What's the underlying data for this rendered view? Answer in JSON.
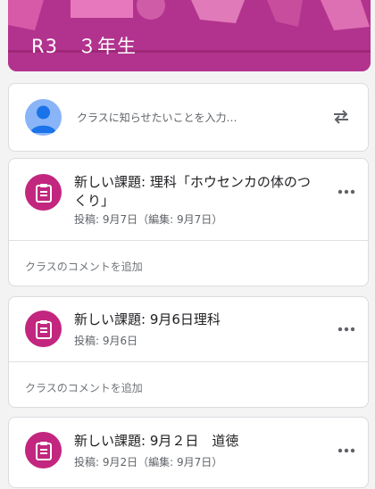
{
  "banner": {
    "title": "R3　３年生",
    "color": "#b2338e"
  },
  "composer": {
    "placeholder": "クラスに知らせたいことを入力…",
    "avatar_icon": "person-icon",
    "repost_icon": "repost-icon"
  },
  "posts": [
    {
      "title": "新しい課題: 理科「ホウセンカの体のつくり」",
      "meta": "投稿: 9月7日（編集: 9月7日）",
      "comment": "クラスのコメントを追加"
    },
    {
      "title": "新しい課題: 9月6日理科",
      "meta": "投稿: 9月6日",
      "comment": "クラスのコメントを追加"
    },
    {
      "title": "新しい課題: 9月２日　道徳",
      "meta": "投稿: 9月2日（編集: 9月7日）"
    }
  ],
  "colors": {
    "accent": "#c2267f",
    "background": "#f3f3f4"
  }
}
